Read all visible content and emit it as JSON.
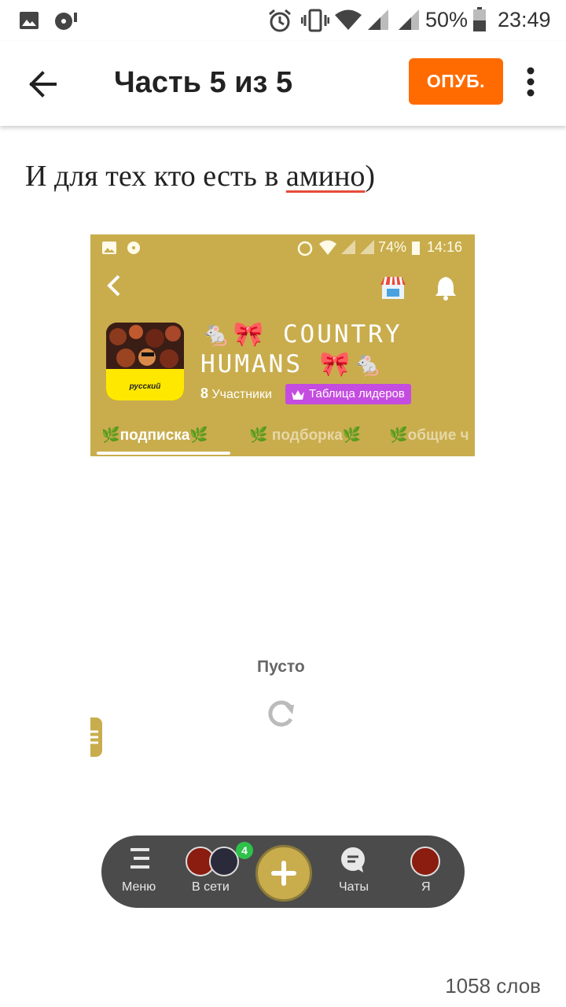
{
  "status_bar": {
    "battery": "50%",
    "time": "23:49"
  },
  "app_bar": {
    "title": "Часть 5 из 5",
    "publish_label": "ОПУБ."
  },
  "content": {
    "text_before": "И для тех кто есть в ",
    "text_underlined": "амино",
    "text_after": ")"
  },
  "embedded_screenshot": {
    "status_battery": "74%",
    "status_time": "14:16",
    "avatar_label": "русский",
    "community_title_line1": "🐁🎀 COUNTRY",
    "community_title_line2": "HUMANS 🎀🐁",
    "members_count": "8",
    "members_label": "Участники",
    "leaderboard_label": "Таблица лидеров",
    "tabs": [
      "🌿подписка🌿",
      "🌿 подборка🌿",
      "🌿общие ч"
    ],
    "empty_label": "Пусто",
    "nav": {
      "menu": "Меню",
      "online": "В сети",
      "online_badge": "4",
      "chats": "Чаты",
      "me": "Я"
    }
  },
  "footer": {
    "word_count": "1058 слов"
  },
  "colors": {
    "accent": "#ff6b00",
    "amino_gold": "#c9ad4d",
    "leaderboard": "#c44ce0"
  }
}
